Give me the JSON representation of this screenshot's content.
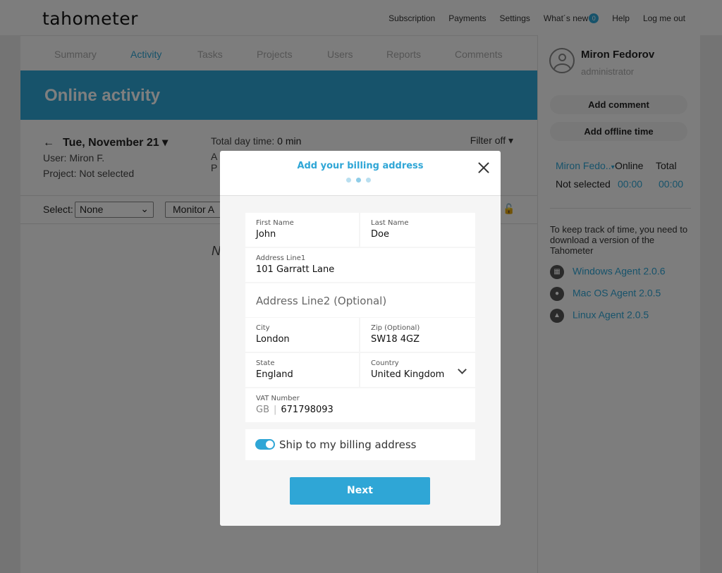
{
  "app": {
    "logo": "tahometer"
  },
  "topnav": {
    "subscription": "Subscription",
    "payments": "Payments",
    "settings": "Settings",
    "whats_new": "What´s new",
    "whats_new_badge": "0",
    "help": "Help",
    "logout": "Log me out"
  },
  "tabs": [
    {
      "label": "Summary",
      "active": false
    },
    {
      "label": "Activity",
      "active": true
    },
    {
      "label": "Tasks",
      "active": false
    },
    {
      "label": "Projects",
      "active": false
    },
    {
      "label": "Users",
      "active": false
    },
    {
      "label": "Reports",
      "active": false
    },
    {
      "label": "Comments",
      "active": false
    }
  ],
  "banner": {
    "title": "Online activity"
  },
  "day": {
    "date": "Tue, November 21",
    "user": "User: Miron F.",
    "project": "Project: Not selected",
    "total_label": "Total day time:",
    "total_value": "0 min",
    "cut_a": "A",
    "cut_p": "P",
    "filter": "Filter off"
  },
  "selectbar": {
    "label": "Select:",
    "select_value": "None",
    "monitor_value": "Monitor A"
  },
  "main": {
    "nodata_fragment": "N"
  },
  "sidebar": {
    "name": "Miron Fedorov",
    "role": "administrator",
    "add_comment": "Add comment",
    "add_offline": "Add offline time",
    "table_head": {
      "user": "Miron Fedo..",
      "online": "Online",
      "total": "Total"
    },
    "table_row": {
      "project": "Not selected",
      "online": "00:00",
      "total": "00:00"
    },
    "note": "To keep track of time, you need to download a version of the Tahometer",
    "agents": [
      {
        "label": "Windows Agent 2.0.6",
        "icon": "windows-icon"
      },
      {
        "label": "Mac OS Agent 2.0.5",
        "icon": "apple-icon"
      },
      {
        "label": "Linux Agent 2.0.5",
        "icon": "linux-icon"
      }
    ]
  },
  "modal": {
    "title": "Add your billing address",
    "step": 2,
    "steps_total": 3,
    "first_name": {
      "label": "First Name",
      "value": "John"
    },
    "last_name": {
      "label": "Last Name",
      "value": "Doe"
    },
    "address1": {
      "label": "Address Line1",
      "value": "101 Garratt Lane"
    },
    "address2": {
      "placeholder": "Address Line2 (Optional)"
    },
    "city": {
      "label": "City",
      "value": "London"
    },
    "zip": {
      "label": "Zip (Optional)",
      "value": "SW18 4GZ"
    },
    "state": {
      "label": "State",
      "value": "England"
    },
    "country": {
      "label": "Country",
      "value": "United Kingdom"
    },
    "vat": {
      "label": "VAT Number",
      "prefix": "GB",
      "value": "671798093"
    },
    "ship_toggle": {
      "label": "Ship to my billing address",
      "checked": true
    },
    "next": "Next"
  },
  "colors": {
    "accent": "#2fa6d6",
    "overlay": "rgba(0,0,0,0.5)"
  }
}
